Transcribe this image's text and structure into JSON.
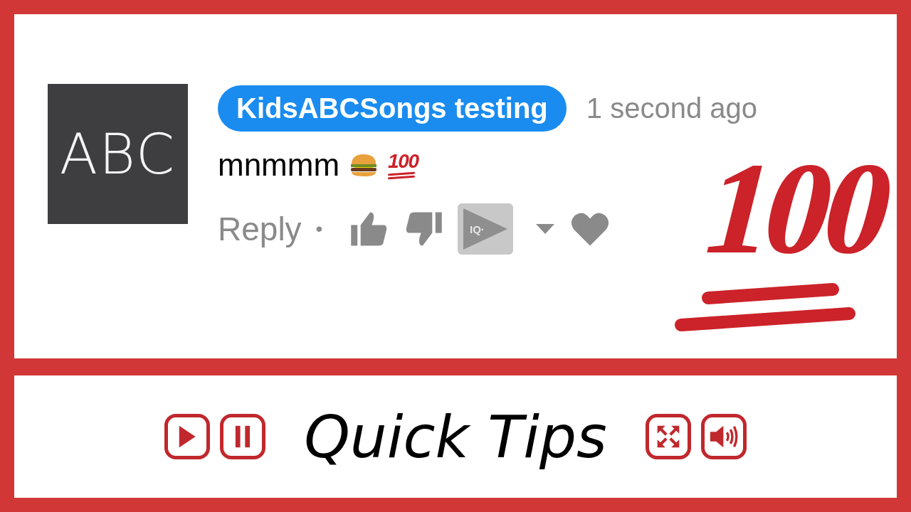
{
  "comment": {
    "avatar_text": "ABC",
    "author": "KidsABCSongs testing",
    "author_highlighted": true,
    "time": "1 second ago",
    "text": "mnmmm",
    "emojis": [
      {
        "kind": "burger"
      },
      {
        "kind": "hundred",
        "text": "100"
      }
    ],
    "actions": {
      "reply": "Reply",
      "separator": "•",
      "badge_text": "IQ·"
    }
  },
  "big_emoji": {
    "text": "100"
  },
  "footer": {
    "title": "Quick Tips",
    "controls": [
      {
        "kind": "play"
      },
      {
        "kind": "pause"
      },
      {
        "kind": "spacer"
      },
      {
        "kind": "fullscreen"
      },
      {
        "kind": "volume"
      }
    ]
  }
}
